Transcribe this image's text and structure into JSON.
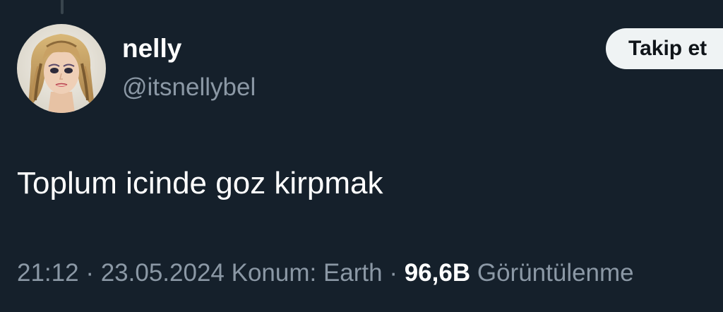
{
  "author": {
    "display_name": "nelly",
    "handle": "@itsnellybel"
  },
  "follow_button": {
    "label": "Takip et"
  },
  "tweet": {
    "text": "Toplum icinde goz kirpmak"
  },
  "meta": {
    "time": "21:12",
    "separator": " · ",
    "date": "23.05.2024",
    "location": "Konum: Earth",
    "views_count": "96,6B",
    "views_label": " Görüntülenme"
  },
  "colors": {
    "background": "#15202b",
    "primary_text": "#ffffff",
    "secondary_text": "#8b98a5",
    "follow_button_bg": "#eff3f4"
  },
  "icons": {
    "avatar": "doll-profile-photo"
  }
}
